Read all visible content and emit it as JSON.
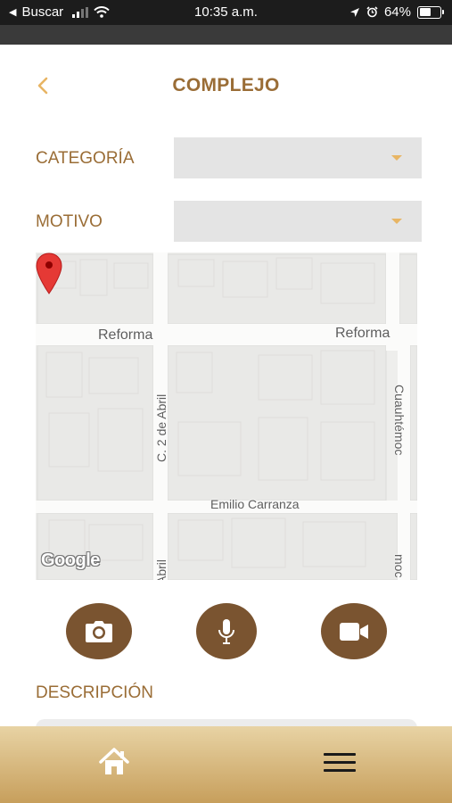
{
  "status_bar": {
    "back_app": "Buscar",
    "time": "10:35 a.m.",
    "battery": "64%",
    "battery_level": 0.64
  },
  "header": {
    "title": "COMPLEJO",
    "back_icon": "chevron-left-icon"
  },
  "form": {
    "categoria_label": "CATEGORÍA",
    "categoria_value": "",
    "motivo_label": "MOTIVO",
    "motivo_value": ""
  },
  "map": {
    "streets": {
      "reforma_left": "Reforma",
      "reforma_right": "Reforma",
      "abril_vertical": "C. 2 de Abril",
      "abril_bottom": "Abril",
      "cuauhtemoc": "Cuauhtémoc",
      "cuauhtemoc_bottom": "moc",
      "carranza": "Emilio Carranza"
    },
    "logo": "Google",
    "pin_icon": "map-pin-icon"
  },
  "media": {
    "camera_icon": "camera-icon",
    "mic_icon": "microphone-icon",
    "video_icon": "video-camera-icon"
  },
  "description": {
    "label": "DESCRIPCIÓN",
    "value": ""
  },
  "bottom_nav": {
    "home_icon": "home-icon",
    "menu_icon": "hamburger-menu-icon"
  },
  "colors": {
    "brand_brown": "#9a6d36",
    "button_brown": "#7a5430",
    "accent_orange": "#e8b564",
    "pin_red": "#e53935",
    "nav_gold": "#c79f5c"
  }
}
